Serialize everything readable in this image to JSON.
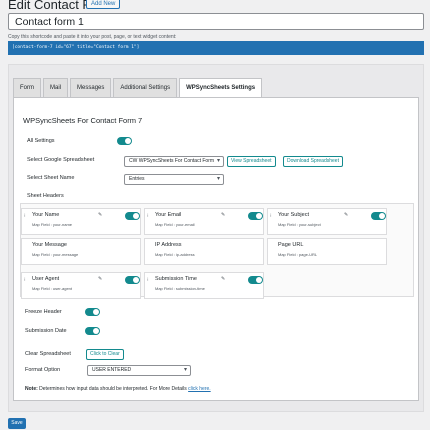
{
  "page": {
    "title": "Edit Contact Form",
    "add_new": "Add New",
    "form_title_value": "Contact form 1",
    "copy_hint": "Copy this shortcode and paste it into your post, page, or text widget content:",
    "shortcode": "[contact-form-7 id=\"67\" title=\"Contact form 1\"]",
    "save_label": "Save"
  },
  "tabs": [
    {
      "label": "Form"
    },
    {
      "label": "Mail"
    },
    {
      "label": "Messages"
    },
    {
      "label": "Additional Settings"
    },
    {
      "label": "WPSyncSheets Settings"
    }
  ],
  "settings": {
    "heading": "WPSyncSheets For Contact Form 7",
    "all_settings": "All Settings",
    "select_spreadsheet": "Select Google Spreadsheet",
    "spreadsheet_value": "CW WPSyncSheets For Contact Form",
    "view_spreadsheet": "View Spreadsheet",
    "download_spreadsheet": "Download Spreadsheet",
    "select_sheet": "Select Sheet Name",
    "sheet_value": "Entries",
    "sheet_headers": "Sheet Headers",
    "freeze_header": "Freeze Header",
    "submission_date": "Submission Date",
    "clear_spreadsheet": "Clear Spreadsheet",
    "click_to_clear": "Click to Clear",
    "format_option": "Format Option",
    "format_value": "USER ENTERED",
    "note_label": "Note:",
    "note_text": " Determines how input data should be interpreted. For More Details ",
    "note_link": "click here."
  },
  "headers": [
    {
      "name": "Your Name",
      "map": "Map Field : your-name",
      "toggle": true
    },
    {
      "name": "Your Email",
      "map": "Map Field : your-email",
      "toggle": true
    },
    {
      "name": "Your Subject",
      "map": "Map Field : your-subject",
      "toggle": true
    },
    {
      "name": "Your Message",
      "map": "Map Field : your-message",
      "toggle": false
    },
    {
      "name": "IP Address",
      "map": "Map Field : ip-address",
      "toggle": false
    },
    {
      "name": "Page URL",
      "map": "Map Field : page-URL",
      "toggle": false
    },
    {
      "name": "User Agent",
      "map": "Map Field : user-agent",
      "toggle": true
    },
    {
      "name": "Submission Time",
      "map": "Map Field : submission-time",
      "toggle": true
    }
  ],
  "colors": {
    "accent": "#138a8e",
    "primary": "#2271b1"
  }
}
